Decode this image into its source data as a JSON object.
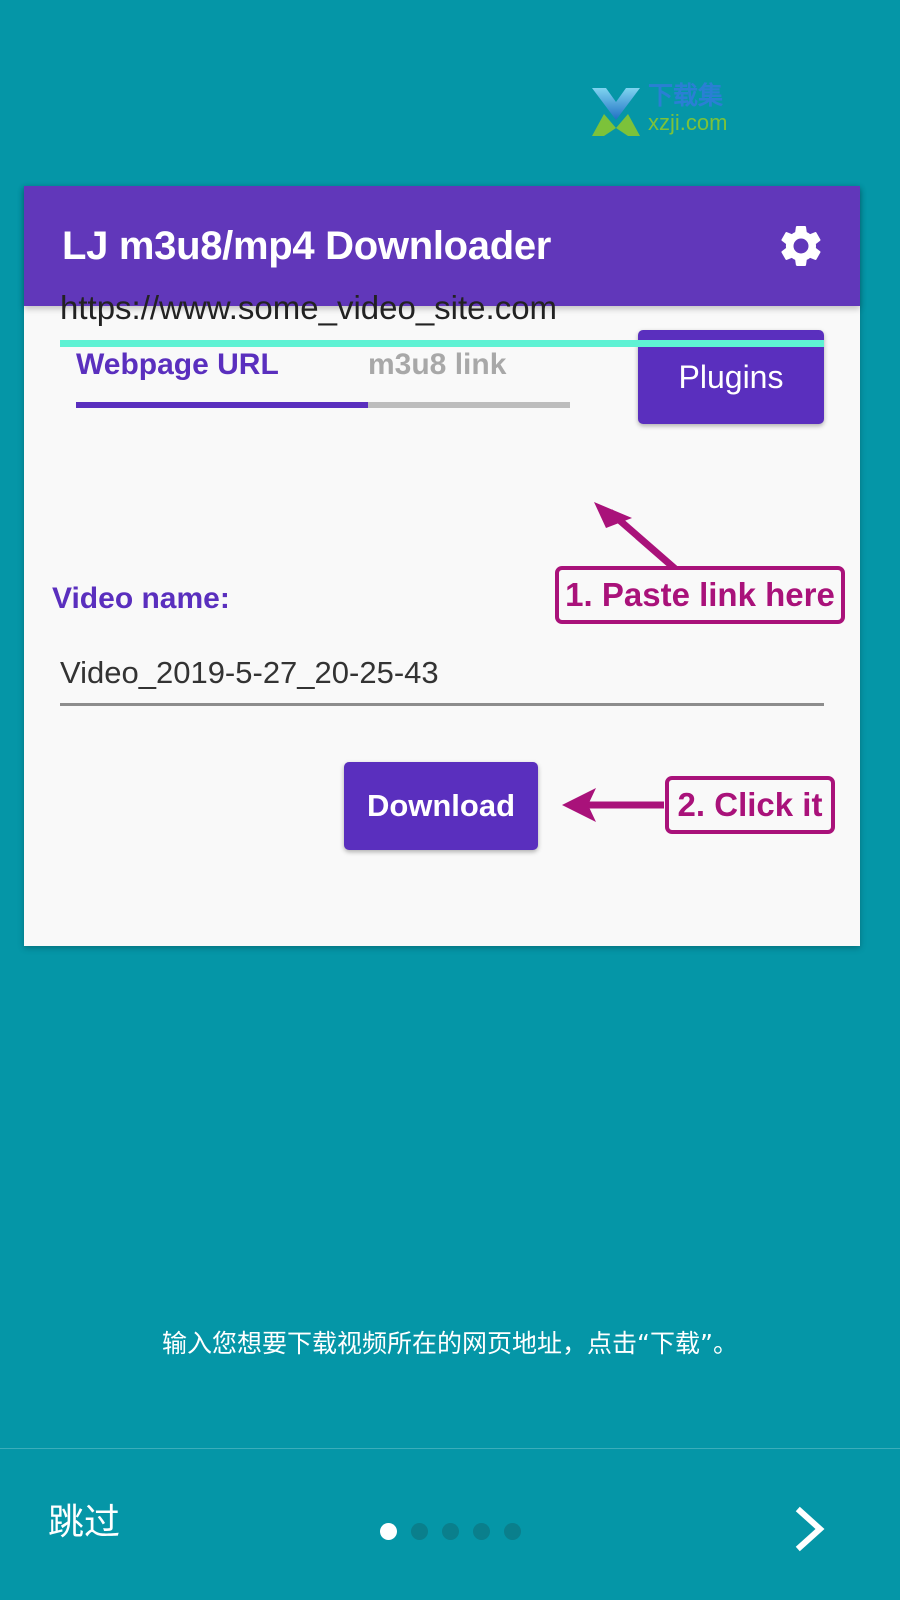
{
  "watermark": {
    "name": "xzji-logo-watermark",
    "text_cn": "下载集",
    "text_en": "xzji.com",
    "color_cn": "#2a7fd4",
    "color_en": "#7cc23a"
  },
  "theme": {
    "background": "#0596a7",
    "card_background": "#f9f9f9",
    "primary_purple": "#5a2fbe",
    "header_purple": "#6137ba",
    "annotation_magenta": "#a9127a",
    "url_underline_teal": "#5ff2d4",
    "dot_inactive": "#0a7f8c"
  },
  "app": {
    "title": "LJ m3u8/mp4 Downloader",
    "settings_icon": "gear-icon"
  },
  "tabs": [
    {
      "label": "Webpage URL",
      "active": true
    },
    {
      "label": "m3u8 link",
      "active": false
    }
  ],
  "plugins_button": {
    "label": "Plugins"
  },
  "url_field": {
    "value": "https://www.some_video_site.com",
    "placeholder": "https://www.some_video_site.com"
  },
  "video_name": {
    "label": "Video name:",
    "value": "Video_2019-5-27_20-25-43",
    "placeholder": "Video_2019-5-27_20-25-43"
  },
  "download_button": {
    "label": "Download"
  },
  "annotations": [
    {
      "id": "paste",
      "label": "1. Paste link here",
      "arrow": "arrow-up-left"
    },
    {
      "id": "click",
      "label": "2. Click it",
      "arrow": "arrow-left"
    }
  ],
  "bottom_hint": "输入您想要下载视频所在的网页地址，点击“下载”。",
  "bottom_nav": {
    "skip_label": "跳过",
    "next_icon": "chevron-right-icon",
    "dots_total": 5,
    "dots_active_index": 0
  }
}
